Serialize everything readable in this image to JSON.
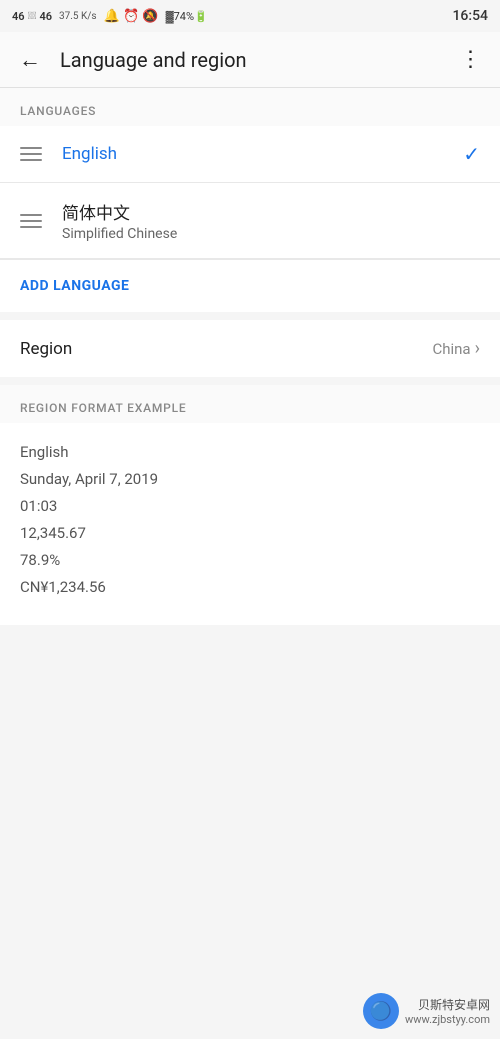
{
  "statusBar": {
    "signalLeft": "46",
    "signalMid": "46",
    "dataSpeed": "37.5 K/s",
    "time": "16:54",
    "batteryPercent": "74"
  },
  "appBar": {
    "title": "Language and region",
    "backLabel": "←",
    "moreLabel": "⋮"
  },
  "languagesSection": {
    "header": "LANGUAGES",
    "languages": [
      {
        "name": "English",
        "subtitle": "",
        "isSelected": true
      },
      {
        "name": "简体中文",
        "subtitle": "Simplified Chinese",
        "isSelected": false
      }
    ],
    "addLanguageLabel": "ADD LANGUAGE"
  },
  "regionSection": {
    "label": "Region",
    "value": "China"
  },
  "formatSection": {
    "header": "REGION FORMAT EXAMPLE",
    "lines": [
      "English",
      "Sunday, April 7, 2019",
      "01:03",
      "12,345.67",
      "78.9%",
      "CN¥1,234.56"
    ]
  },
  "watermark": {
    "siteName": "贝斯特安卓网",
    "url": "www.zjbstyy.com"
  }
}
